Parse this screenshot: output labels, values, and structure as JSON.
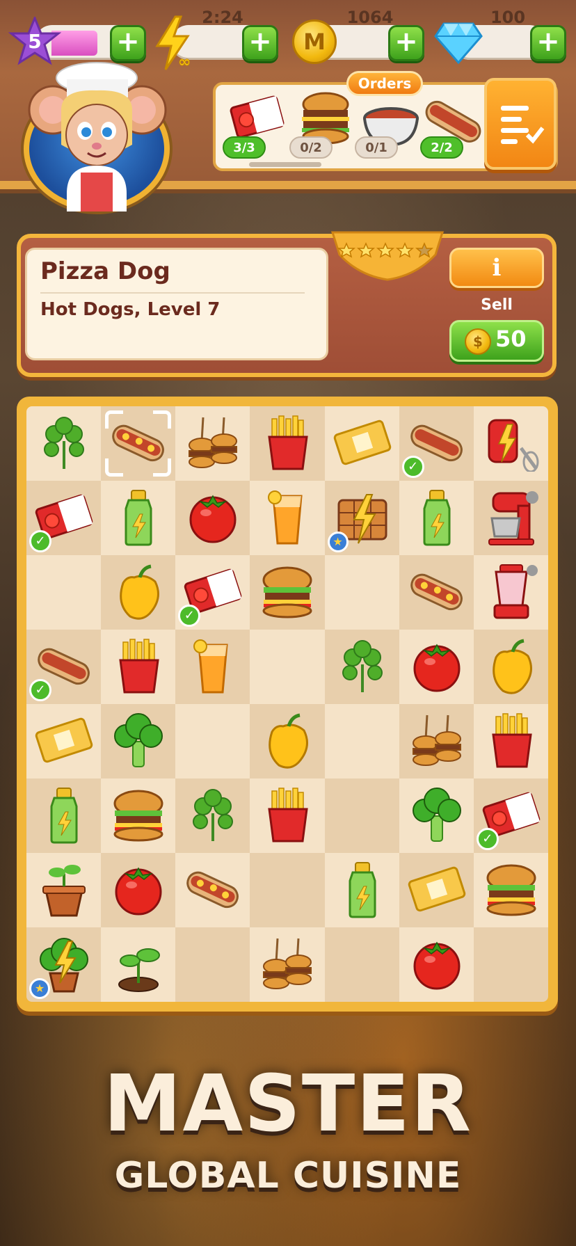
{
  "hud": {
    "level": "5",
    "energy_timer": "2:24",
    "coins": "1064",
    "coin_symbol": "M",
    "gems": "100",
    "plus": "+"
  },
  "orders": {
    "tab_label": "Orders",
    "items": [
      {
        "icon": "ketchup-packet-icon",
        "progress": "3/3",
        "done": true
      },
      {
        "icon": "burger-icon",
        "progress": "0/2",
        "done": false
      },
      {
        "icon": "soup-bowl-icon",
        "progress": "0/1",
        "done": false
      },
      {
        "icon": "hot-dog-icon",
        "progress": "2/2",
        "done": true
      }
    ]
  },
  "item_info": {
    "name": "Pizza Dog",
    "subtitle": "Hot Dogs, Level 7",
    "stars": 5,
    "info_label": "i",
    "sell_label": "Sell",
    "sell_price": "50",
    "coin_symbol": "$"
  },
  "board": {
    "rows": [
      [
        "parsley",
        "pizza-dog",
        "slider-skewer",
        "fries",
        "cheese-packet",
        "hot-dog",
        "mixer-generator"
      ],
      [
        "ketchup-packet",
        "green-bottle",
        "tomato",
        "orange-juice",
        "waffle-generator",
        "green-bottle",
        "stand-mixer"
      ],
      [
        "",
        "yellow-pepper",
        "ketchup-packet",
        "burger",
        "",
        "pizza-dog",
        "blender"
      ],
      [
        "hot-dog",
        "fries",
        "orange-juice",
        "",
        "parsley",
        "tomato",
        "yellow-pepper"
      ],
      [
        "cheese-packet",
        "broccoli",
        "",
        "yellow-pepper",
        "",
        "slider-skewer",
        "fries"
      ],
      [
        "green-bottle",
        "burger",
        "parsley",
        "fries",
        "",
        "broccoli",
        "ketchup-packet"
      ],
      [
        "sprout-pot",
        "tomato",
        "pizza-dog",
        "",
        "green-bottle",
        "cheese-packet",
        "burger"
      ],
      [
        "herb-bush-generator",
        "seedling",
        "",
        "slider-skewer",
        "",
        "tomato",
        ""
      ]
    ],
    "checks": [
      [
        0,
        5
      ],
      [
        1,
        0
      ],
      [
        2,
        2
      ],
      [
        3,
        0
      ],
      [
        5,
        6
      ]
    ],
    "star_badges": [
      [
        1,
        4
      ],
      [
        7,
        0
      ]
    ],
    "selected": [
      0,
      1
    ]
  },
  "headline": {
    "big": "MASTER",
    "small": "GLOBAL CUISINE"
  }
}
